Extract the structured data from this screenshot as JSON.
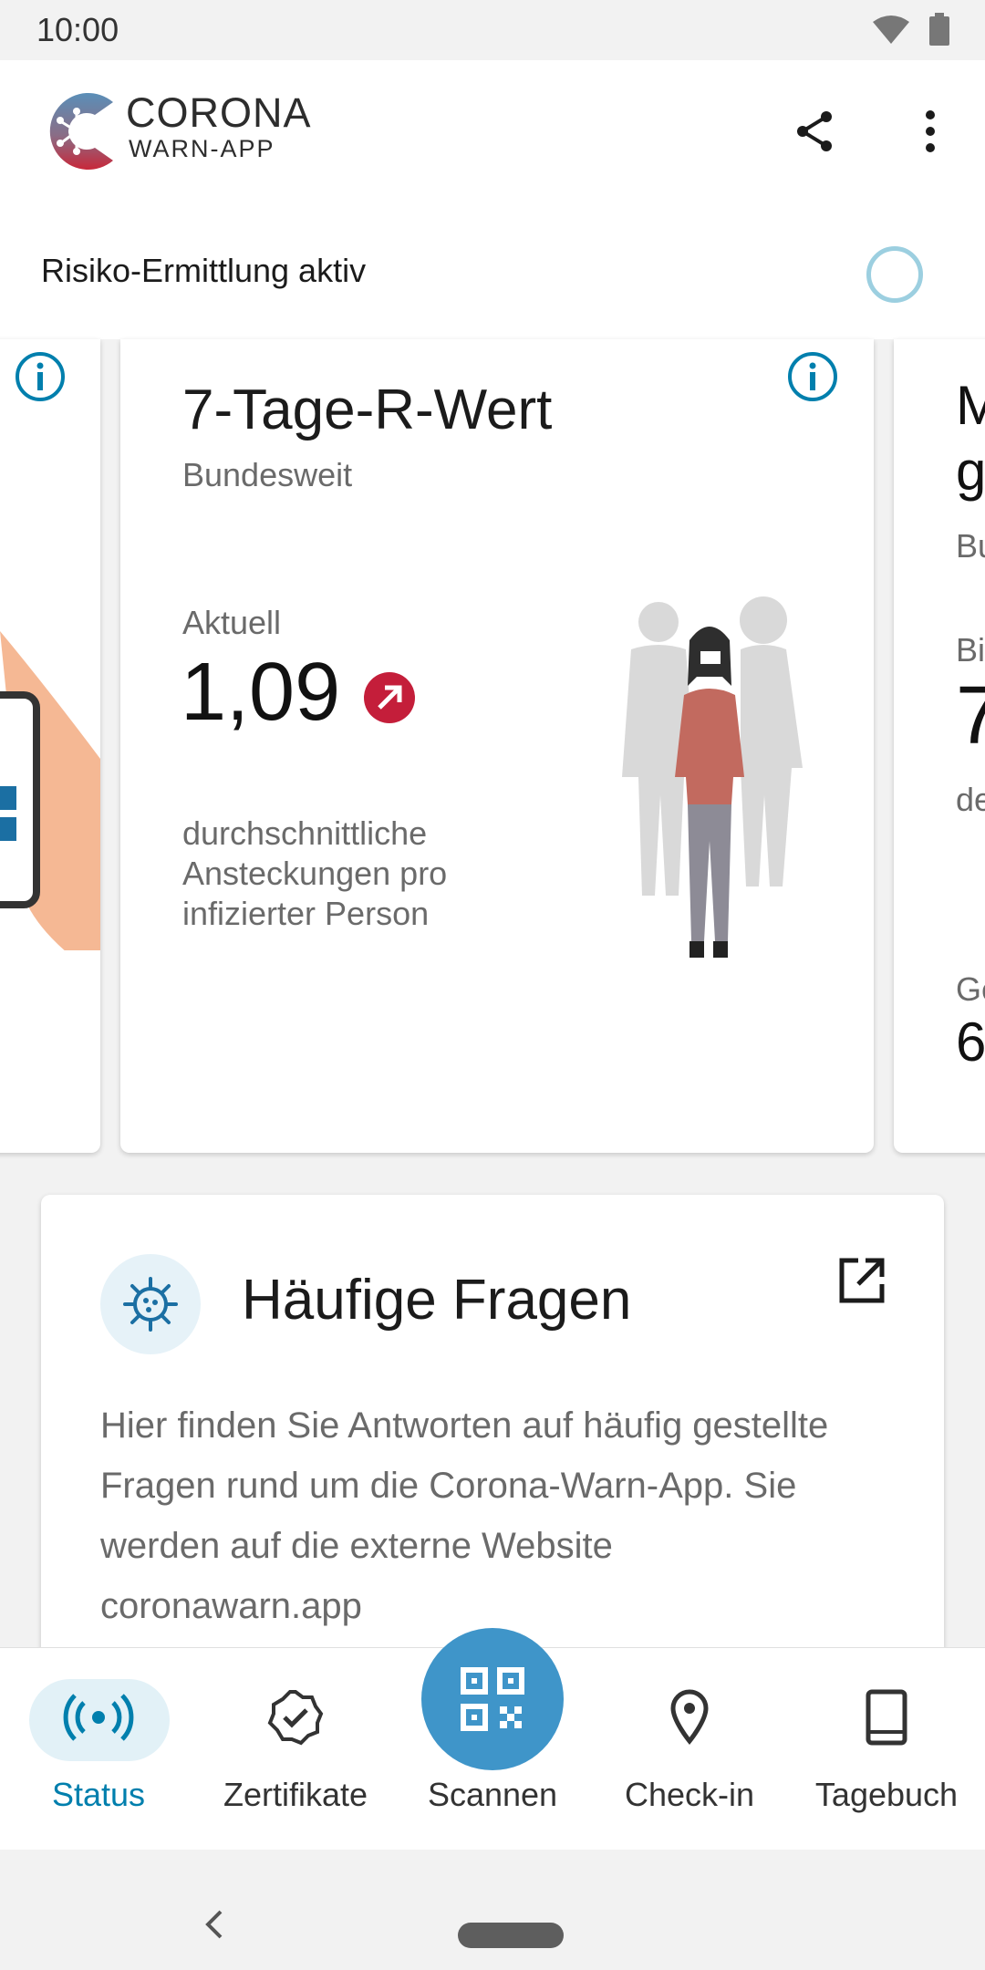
{
  "status_bar": {
    "time": "10:00"
  },
  "app": {
    "logo_line1": "CORONA",
    "logo_line2": "WARN-APP",
    "risk_label": "Risiko-Ermittlung aktiv"
  },
  "main_card": {
    "title": "7-Tage-R-Wert",
    "subtitle": "Bundesweit",
    "current_label": "Aktuell",
    "value": "1,09",
    "trend": "up",
    "description": "durchschnittliche Ansteckungen pro infizierter Person"
  },
  "right_peek": {
    "title_line1": "M",
    "title_line2": "g",
    "sub": "Bu",
    "label": "Bi",
    "value": "7",
    "desc": "de",
    "label2": "Ge",
    "value2": "6"
  },
  "faq": {
    "title": "Häufige Fragen",
    "body": "Hier finden Sie Antworten auf häufig gestellte Fragen rund um die Corona-Warn-App. Sie werden auf die externe Website coronawarn.app"
  },
  "bottom_nav": {
    "items": [
      {
        "label": "Status",
        "icon": "status-broadcast-icon",
        "active": true
      },
      {
        "label": "Zertifikate",
        "icon": "certificate-icon",
        "active": false
      },
      {
        "label": "Scannen",
        "icon": "qr-code-icon",
        "active": false
      },
      {
        "label": "Check-in",
        "icon": "location-pin-icon",
        "active": false
      },
      {
        "label": "Tagebuch",
        "icon": "book-icon",
        "active": false
      }
    ]
  },
  "colors": {
    "accent": "#007fad",
    "fab": "#3f95c9",
    "trend_red": "#c41e3a"
  }
}
